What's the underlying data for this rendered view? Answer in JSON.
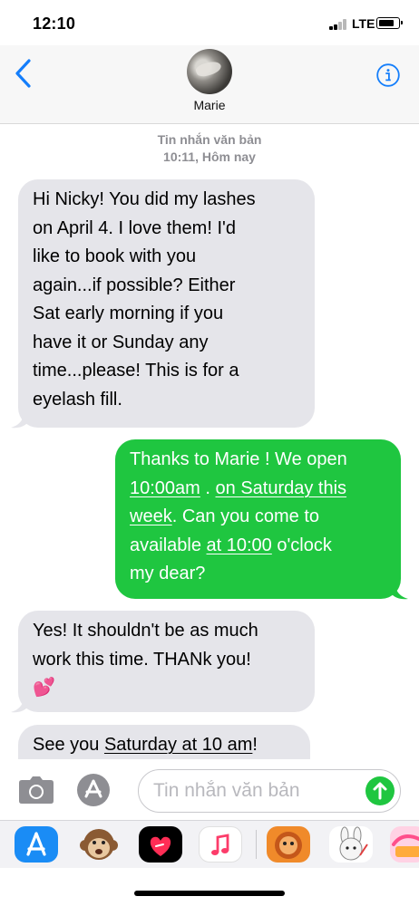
{
  "status_bar": {
    "time": "12:10",
    "network": "LTE"
  },
  "header": {
    "contact_name": "Marie"
  },
  "thread": {
    "label": "Tin nhắn văn bản",
    "timestamp": "10:11, Hôm nay"
  },
  "messages": [
    {
      "direction": "incoming",
      "lines": [
        "Hi Nicky! You did  my lashes",
        "on April 4. I love them! I'd",
        "like to book with you",
        "again...if possible? Either",
        "Sat early morning if you",
        "have it or Sunday any",
        "time...please! This is for a",
        "eyelash fill."
      ]
    },
    {
      "direction": "outgoing",
      "line1": "Thanks to Marie ! We open",
      "line2_link1": "10:00am",
      "line2_mid": " . ",
      "line2_link2": "on Saturday this",
      "line3_link": "week",
      "line3_rest": ". Can you come to",
      "line4_pre": "available ",
      "line4_link": "at 10:00",
      "line4_post": " o'clock",
      "line5": "my dear?"
    },
    {
      "direction": "incoming",
      "line1": "Yes! It shouldn't be as much",
      "line2": "work this time. THANk you!",
      "emoji": "💕"
    },
    {
      "direction": "incoming",
      "pre": "See you ",
      "link": "Saturday at 10 am",
      "post": "!"
    }
  ],
  "input": {
    "placeholder": "Tin nhắn văn bản"
  },
  "colors": {
    "outgoing": "#1fc640",
    "incoming": "#e5e5ea",
    "accent": "#147efb"
  },
  "drawer_apps": [
    "app-store-icon",
    "animoji-monkey-icon",
    "digital-touch-icon",
    "music-icon",
    "sticker-pack-icon",
    "sticker-bunny-icon",
    "sticker-pack-icon-2"
  ]
}
